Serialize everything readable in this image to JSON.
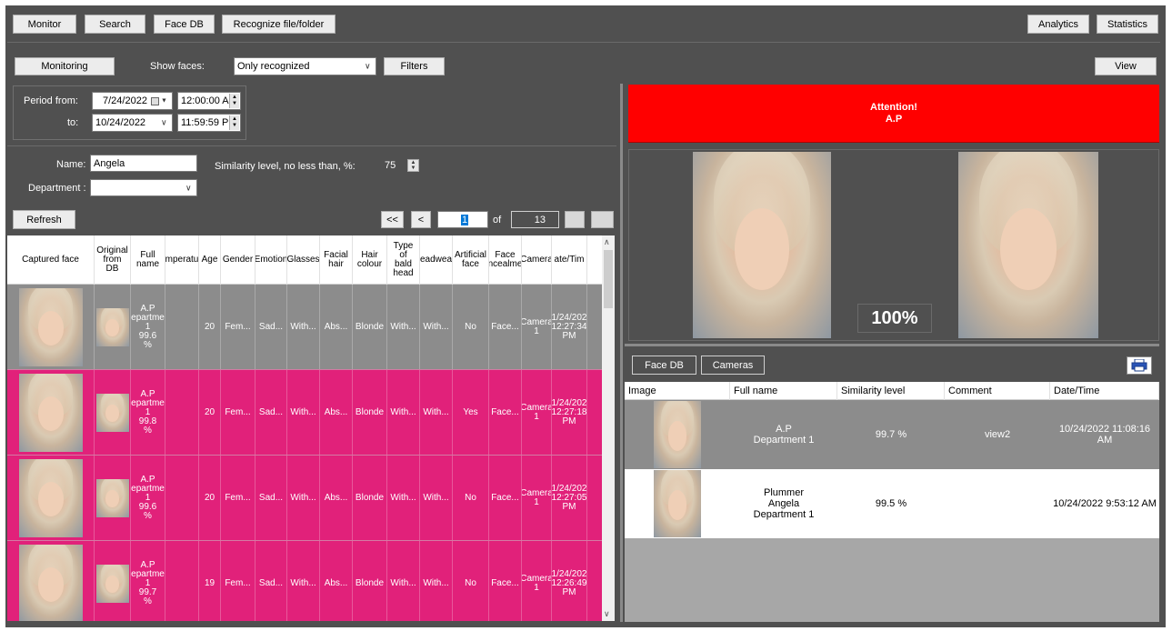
{
  "topbar": {
    "monitor": "Monitor",
    "search": "Search",
    "face_db": "Face DB",
    "recognize": "Recognize file/folder",
    "analytics": "Analytics",
    "statistics": "Statistics"
  },
  "toolbar": {
    "monitoring": "Monitoring",
    "show_faces_label": "Show faces:",
    "show_faces_value": "Only recognized",
    "filters": "Filters",
    "view": "View"
  },
  "period": {
    "from_label": "Period from:",
    "to_label": "to:",
    "from_date": "7/24/2022",
    "from_time": "12:00:00 A",
    "to_date": "10/24/2022",
    "to_time": "11:59:59 P"
  },
  "filters": {
    "name_label": "Name:",
    "name_value": "Angela",
    "department_label": "Department :",
    "department_value": "",
    "similarity_label": "Similarity level, no less than, %:",
    "similarity_value": "75"
  },
  "pager": {
    "refresh": "Refresh",
    "first": "<<",
    "prev": "<",
    "page": "1",
    "of": "of",
    "total": "13",
    "next": ">",
    "last": ">>"
  },
  "grid": {
    "headers": [
      "Captured face",
      "Original from DB",
      "Full name",
      "Temperature",
      "Age",
      "Gender",
      "Emotion",
      "Glasses",
      "Facial hair",
      "Hair colour",
      "Type of bald head",
      "Headwear",
      "Artificial face",
      "Face concealment",
      "Camera",
      "Date/Time"
    ],
    "header_display": [
      "Captured face",
      "Original\nfrom\nDB",
      "Full\nname",
      "mperatu",
      "Age",
      "Gender",
      "Emotion",
      "Glasses",
      "Facial\nhair",
      "Hair\ncolour",
      "Type\nof\nbald\nhead",
      "eadwea",
      "Artificial\nface",
      "Face\nncealme",
      "Camera",
      "ate/Tim"
    ],
    "rows": [
      {
        "name": "A.P\nepartme\n1\n99.6\n%",
        "temp": "",
        "age": "20",
        "gender": "Fem...",
        "emotion": "Sad...",
        "glasses": "With...",
        "facial_hair": "Abs...",
        "hair": "Blonde",
        "bald": "With...",
        "headwear": "With...",
        "artificial": "No",
        "concealment": "Face...",
        "camera": "Camera\n1",
        "datetime": "1/24/202\n12:27:34\nPM"
      },
      {
        "name": "A.P\nepartme\n1\n99.8\n%",
        "temp": "",
        "age": "20",
        "gender": "Fem...",
        "emotion": "Sad...",
        "glasses": "With...",
        "facial_hair": "Abs...",
        "hair": "Blonde",
        "bald": "With...",
        "headwear": "With...",
        "artificial": "Yes",
        "concealment": "Face...",
        "camera": "Camera\n1",
        "datetime": "1/24/202\n12:27:18\nPM"
      },
      {
        "name": "A.P\nepartme\n1\n99.6\n%",
        "temp": "",
        "age": "20",
        "gender": "Fem...",
        "emotion": "Sad...",
        "glasses": "With...",
        "facial_hair": "Abs...",
        "hair": "Blonde",
        "bald": "With...",
        "headwear": "With...",
        "artificial": "No",
        "concealment": "Face...",
        "camera": "Camera\n1",
        "datetime": "1/24/202\n12:27:05\nPM"
      },
      {
        "name": "A.P\nepartme\n1\n99.7\n%",
        "temp": "",
        "age": "19",
        "gender": "Fem...",
        "emotion": "Sad...",
        "glasses": "With...",
        "facial_hair": "Abs...",
        "hair": "Blonde",
        "bald": "With...",
        "headwear": "With...",
        "artificial": "No",
        "concealment": "Face...",
        "camera": "Camera\n1",
        "datetime": "1/24/202\n12:26:49\nPM"
      }
    ]
  },
  "alert": {
    "title": "Attention!",
    "subtitle": "A.P"
  },
  "compare": {
    "score": "100%"
  },
  "right_tabs": {
    "face_db": "Face DB",
    "cameras": "Cameras"
  },
  "right_grid": {
    "headers": [
      "Image",
      "Full name",
      "Similarity level",
      "Comment",
      "Date/Time"
    ],
    "rows": [
      {
        "name": "A.P\nDepartment 1",
        "similarity": "99.7 %",
        "comment": "view2",
        "datetime": "10/24/2022 11:08:16\nAM"
      },
      {
        "name": "Plummer\nAngela\nDepartment 1",
        "similarity": "99.5 %",
        "comment": "",
        "datetime": "10/24/2022 9:53:12 AM"
      }
    ]
  },
  "colors": {
    "row_selected": "#8c8c8c",
    "row_highlight": "#e1217a",
    "alert_red": "#ff0000"
  }
}
